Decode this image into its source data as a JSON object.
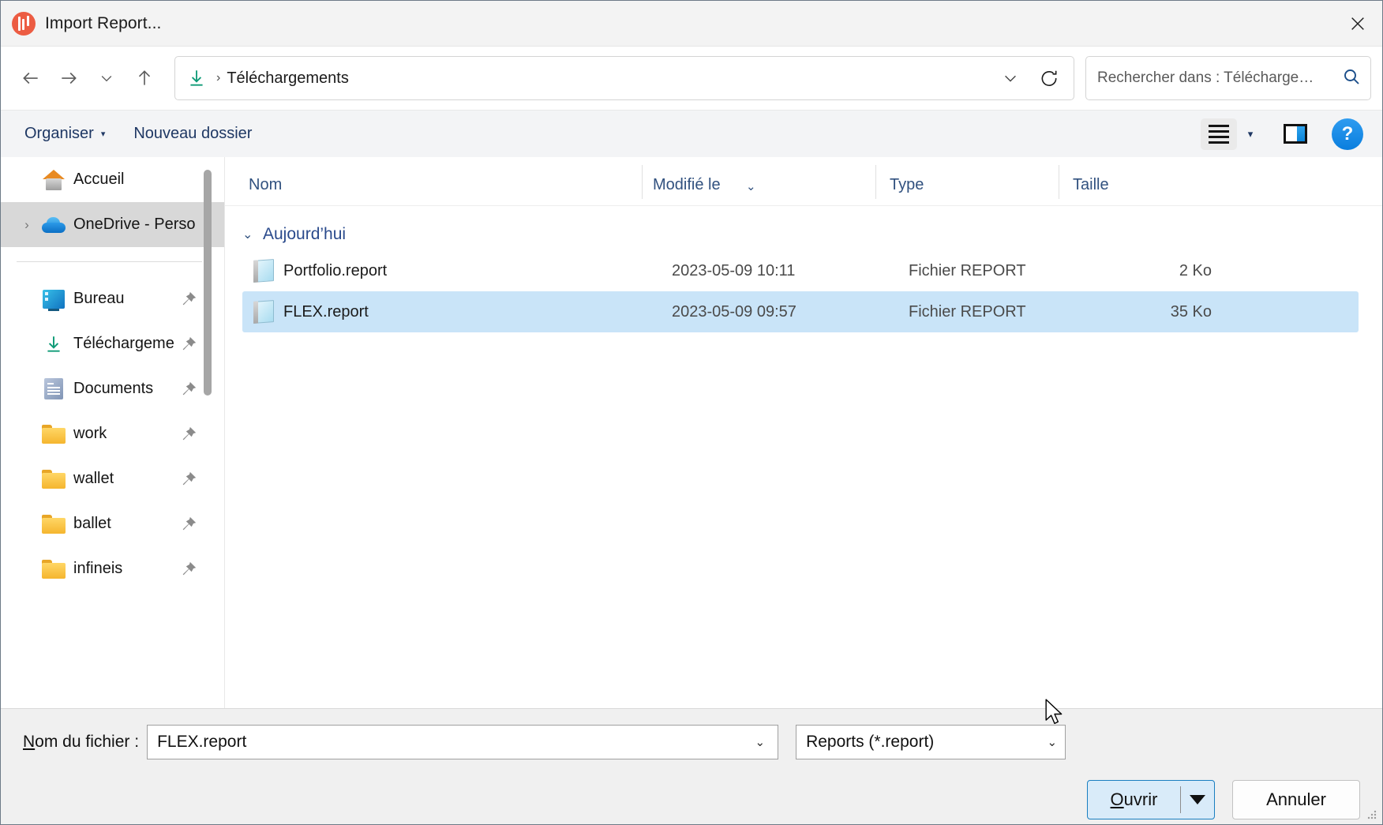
{
  "window": {
    "title": "Import Report...",
    "app_icon": "chart-bars-icon",
    "close_icon": "close-icon",
    "accent_color": "#ec5c43"
  },
  "nav": {
    "back_icon": "back-arrow-icon",
    "forward_icon": "forward-arrow-icon",
    "recent_icon": "chevron-down-icon",
    "up_icon": "up-arrow-icon",
    "address": {
      "location_icon": "downloads-icon",
      "separator": "›",
      "crumb": "Téléchargements",
      "dropdown_icon": "chevron-down-icon",
      "refresh_icon": "refresh-icon"
    },
    "search": {
      "placeholder": "Rechercher dans : Télécharge…",
      "icon": "search-icon"
    }
  },
  "commandbar": {
    "organize_label": "Organiser",
    "organize_caret": "▾",
    "new_folder_label": "Nouveau dossier",
    "view_icon": "list-view-icon",
    "view_caret": "▾",
    "preview_pane_icon": "preview-pane-icon",
    "help_label": "?"
  },
  "sidebar": {
    "items": [
      {
        "label": "Accueil",
        "icon": "home-icon",
        "pinned": false,
        "selected": false,
        "expandable": false
      },
      {
        "label": "OneDrive - Perso",
        "icon": "onedrive-cloud-icon",
        "pinned": false,
        "selected": true,
        "expandable": true
      },
      {
        "label": "Bureau",
        "icon": "desktop-icon",
        "pinned": true,
        "selected": false,
        "expandable": false
      },
      {
        "label": "Téléchargeme",
        "icon": "downloads-icon",
        "pinned": true,
        "selected": false,
        "expandable": false
      },
      {
        "label": "Documents",
        "icon": "documents-icon",
        "pinned": true,
        "selected": false,
        "expandable": false
      },
      {
        "label": "work",
        "icon": "folder-icon",
        "pinned": true,
        "selected": false,
        "expandable": false
      },
      {
        "label": "wallet",
        "icon": "folder-icon",
        "pinned": true,
        "selected": false,
        "expandable": false
      },
      {
        "label": "ballet",
        "icon": "folder-icon",
        "pinned": true,
        "selected": false,
        "expandable": false
      },
      {
        "label": "infineis",
        "icon": "folder-icon",
        "pinned": true,
        "selected": false,
        "expandable": false
      }
    ],
    "pin_icon": "pin-icon",
    "expand_chevron": "›"
  },
  "filelist": {
    "columns": [
      {
        "label": "Nom"
      },
      {
        "label": "Modifié le",
        "sorted": true,
        "sort_icon": "chevron-up-sort-icon"
      },
      {
        "label": "Type"
      },
      {
        "label": "Taille"
      }
    ],
    "group": {
      "chevron": "⌄",
      "label": "Aujourd’hui"
    },
    "rows": [
      {
        "name": "Portfolio.report",
        "modified": "2023-05-09 10:11",
        "type": "Fichier REPORT",
        "size": "2 Ko",
        "icon": "report-file-icon",
        "selected": false
      },
      {
        "name": "FLEX.report",
        "modified": "2023-05-09 09:57",
        "type": "Fichier REPORT",
        "size": "35 Ko",
        "icon": "report-file-icon",
        "selected": true
      }
    ],
    "selection_color": "#c9e4f8"
  },
  "footer": {
    "filename_label_prefix": "N",
    "filename_label_rest": "om du fichier :",
    "filename_value": "FLEX.report",
    "filename_caret": "⌄",
    "filetype_value": "Reports (*.report)",
    "filetype_caret": "⌄",
    "open_label_prefix": "O",
    "open_label_rest": "uvrir",
    "open_split_icon": "dropdown-triangle-icon",
    "cancel_label": "Annuler",
    "resize_grip_icon": "resize-grip-icon",
    "cursor_icon": "mouse-pointer-icon"
  }
}
